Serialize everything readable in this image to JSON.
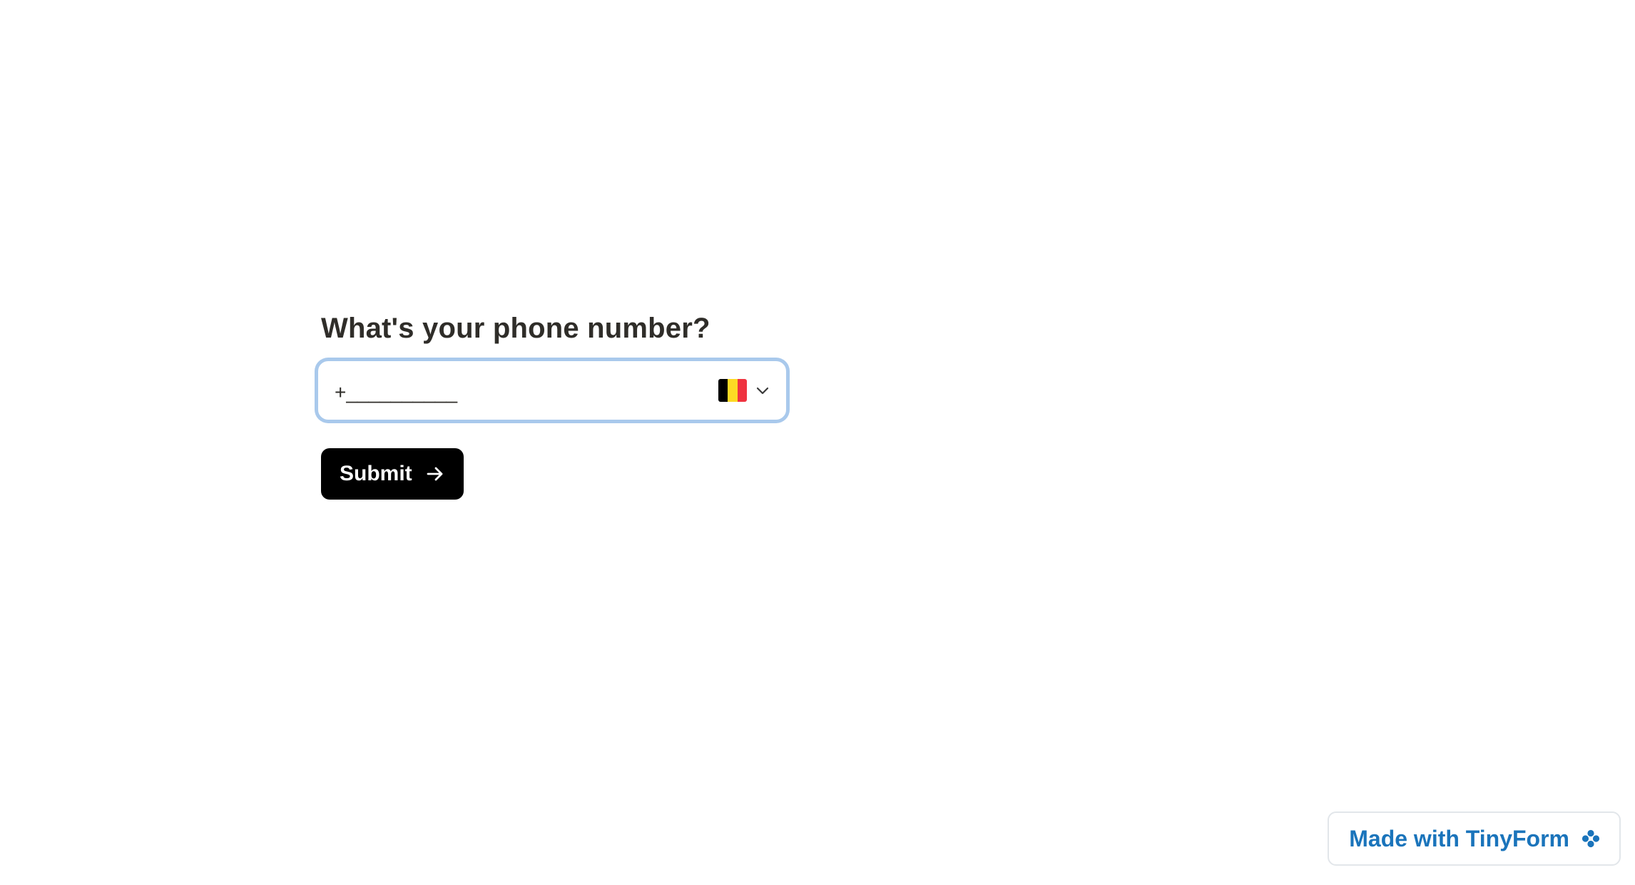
{
  "form": {
    "question": "What's your phone number?",
    "phone_placeholder": "+__________",
    "country": {
      "flag_icon": "belgium-flag-icon",
      "flag_colors": [
        "#000000",
        "#fdda24",
        "#ef3340"
      ]
    },
    "submit_label": "Submit"
  },
  "badge": {
    "label": "Made with TinyForm",
    "icon": "flower-icon",
    "color": "#1a74bb"
  },
  "focus_ring_color": "#a9c9ec"
}
